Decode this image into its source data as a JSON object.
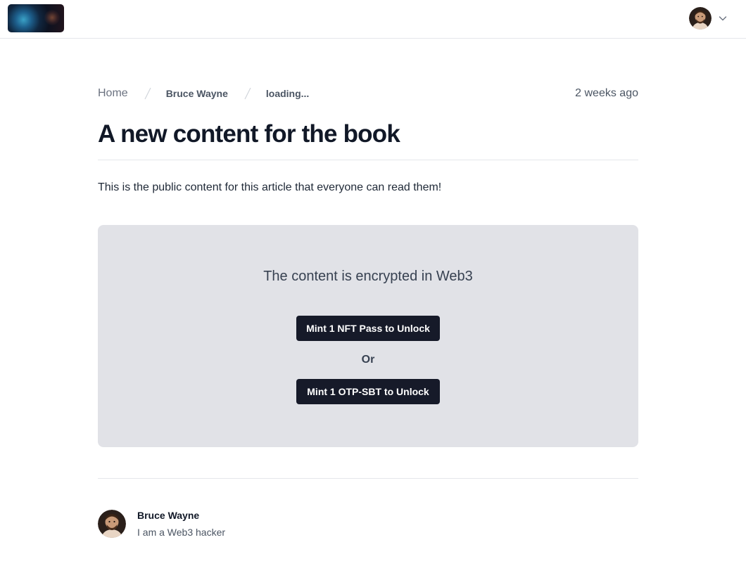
{
  "header": {
    "logo_icon": "galaxy-logo",
    "user_avatar_icon": "user-avatar",
    "menu_icon": "chevron-down-icon"
  },
  "breadcrumb": {
    "home": "Home",
    "author": "Bruce Wayne",
    "current": "loading...",
    "separator_icon": "slash-separator-icon"
  },
  "article": {
    "timestamp": "2 weeks ago",
    "title": "A new content for the book",
    "public_content": "This is the public content for this article that everyone can read them!"
  },
  "locked": {
    "message": "The content is encrypted in Web3",
    "nft_button": "Mint 1 NFT Pass to Unlock",
    "or_label": "Or",
    "sbt_button": "Mint 1 OTP-SBT to Unlock"
  },
  "author": {
    "name": "Bruce Wayne",
    "bio": "I am a Web3 hacker"
  },
  "colors": {
    "button_bg": "#161a29",
    "locked_bg": "#e1e2e7",
    "divider": "#e5e7eb"
  }
}
